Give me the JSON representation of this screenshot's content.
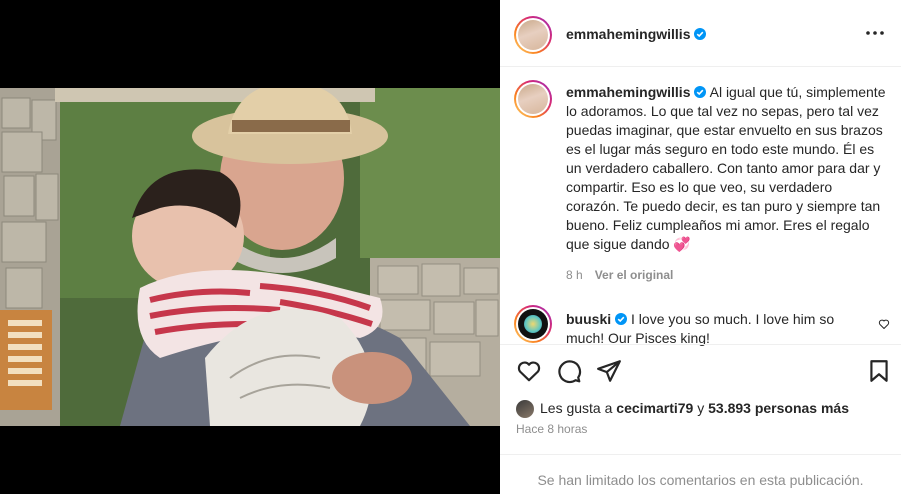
{
  "post": {
    "author": "emmahemingwillis",
    "options_icon": "more-horizontal-icon"
  },
  "caption": {
    "username": "emmahemingwillis",
    "text": "Al igual que tú, simplemente lo adoramos. Lo que tal vez no sepas, pero tal vez puedas imaginar, que estar envuelto en sus brazos es el lugar más seguro en todo este mundo. Él es un verdadero caballero. Con tanto amor para dar y compartir. Eso es lo que veo, su verdadero corazón. Te puedo decir, es tan puro y siempre tan bueno. Feliz cumpleaños mi amor. Eres el regalo que sigue dando 💞",
    "age": "8 h",
    "see_original": "Ver el original"
  },
  "comment": {
    "username": "buuski",
    "text": "I love you so much. I love him so much! Our Pisces king!"
  },
  "likes": {
    "prefix": "Les gusta a",
    "liker": "cecimarti79",
    "joiner": "y",
    "count_text": "53.893 personas más"
  },
  "timestamp": "Hace 8 horas",
  "comments_limited": "Se han limitado los comentarios en esta publicación.",
  "colors": {
    "verified": "#0095f6",
    "text": "#262626",
    "secondary": "#8e8e8e"
  }
}
